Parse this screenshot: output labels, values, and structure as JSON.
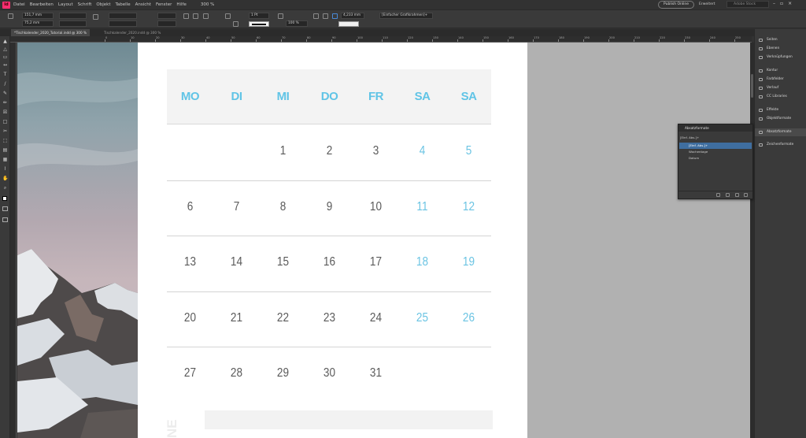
{
  "menu": {
    "items": [
      "Datei",
      "Bearbeiten",
      "Layout",
      "Schrift",
      "Objekt",
      "Tabelle",
      "Ansicht",
      "Fenster",
      "Hilfe"
    ],
    "zoom": "300 %",
    "publish": "Publish Online",
    "workspace": "Erweitert",
    "stock_placeholder": "Adobe Stock"
  },
  "control": {
    "x": "151,7 mm",
    "y": "75,2 mm",
    "stroke_weight": "1 Pt",
    "gap": "4,233 mm",
    "frame_style": "[Einfacher Grafikrahmen]+",
    "scale": "100 %"
  },
  "tabs": [
    {
      "label": "*Tischkalender_2020_Tutorial.indd @ 300 %"
    },
    {
      "label": "Tischkalender_2020.indd @ 300 %"
    }
  ],
  "ruler_ticks": [
    "0",
    "10",
    "20",
    "30",
    "40",
    "50",
    "60",
    "70",
    "80",
    "90",
    "100",
    "110",
    "120",
    "130",
    "140",
    "150",
    "160",
    "170",
    "180",
    "190",
    "200",
    "210",
    "220",
    "230",
    "240",
    "250",
    "260",
    "270"
  ],
  "calendar": {
    "daynames": [
      "MO",
      "DI",
      "MI",
      "DO",
      "FR",
      "SA",
      "SA"
    ],
    "weeks": [
      [
        "",
        "",
        "1",
        "2",
        "3",
        "4",
        "5"
      ],
      [
        "6",
        "7",
        "8",
        "9",
        "10",
        "11",
        "12"
      ],
      [
        "13",
        "14",
        "15",
        "16",
        "17",
        "18",
        "19"
      ],
      [
        "20",
        "21",
        "22",
        "23",
        "24",
        "25",
        "26"
      ],
      [
        "27",
        "28",
        "29",
        "30",
        "31",
        "",
        ""
      ]
    ],
    "footer_glyphs": "NE",
    "accent": "#60c4e6",
    "text_color": "#5a5a5a"
  },
  "dock": {
    "items": [
      "Seiten",
      "Ebenen",
      "Verknüpfungen",
      "Kontur",
      "Farbfelder",
      "Verlauf",
      "CC Libraries",
      "Effekte",
      "Objektformate",
      "Absatzformate",
      "Zeichenformate"
    ],
    "selected": "Absatzformate"
  },
  "para_panel": {
    "title": "Absatzformate",
    "current": "[Einf. Abs.]+",
    "rows": [
      "[Einf. Abs.]+",
      "Wochentage",
      "Datum"
    ],
    "selected_index": 0
  }
}
